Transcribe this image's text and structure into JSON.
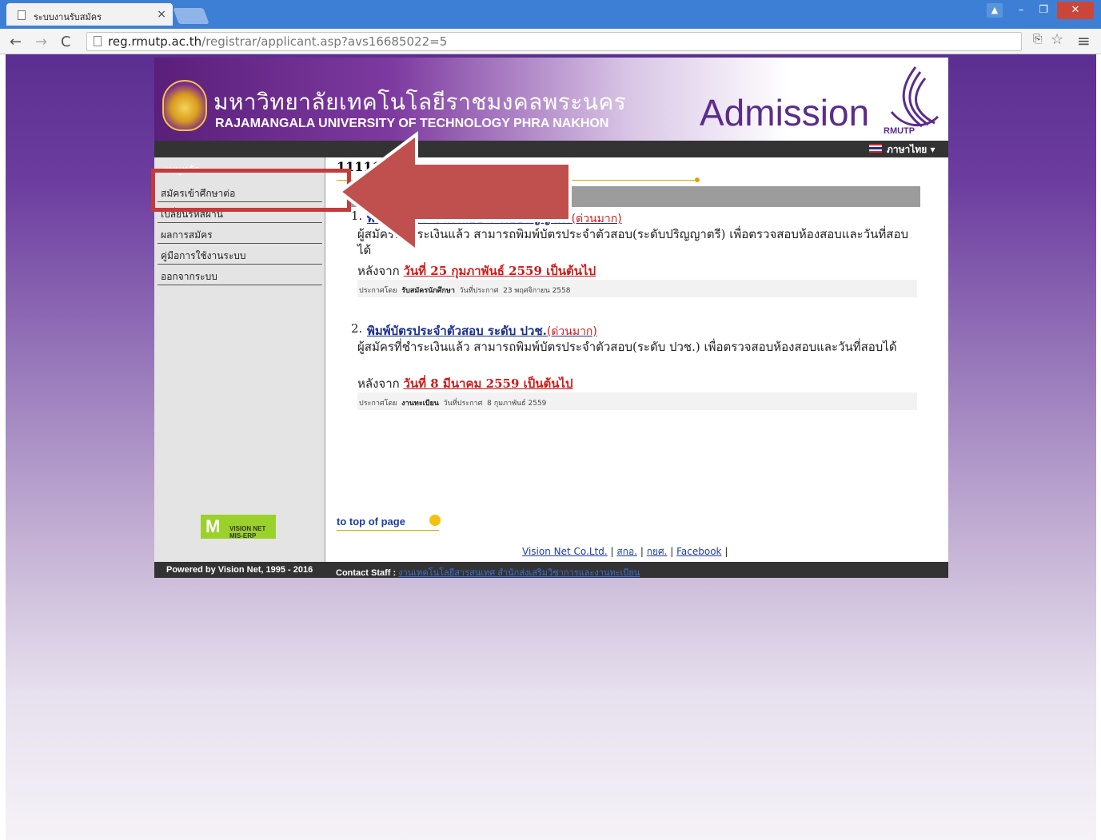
{
  "browser": {
    "tab_title": "ระบบงานรับสมัคร",
    "tab_close": "×",
    "url_host": "reg.rmutp.ac.th",
    "url_path": "/registrar/applicant.asp?avs16685022=5",
    "window_controls": {
      "user": "▲",
      "minimize": "–",
      "maximize": "❐",
      "close": "✕"
    },
    "nav": {
      "back": "←",
      "forward": "→",
      "reload": "C"
    },
    "icons": {
      "translate": "translate-icon",
      "star": "☆",
      "menu": "≡"
    }
  },
  "header": {
    "uni_thai": "มหาวิทยาลัยเทคโนโลยีราชมงคลพระนคร",
    "uni_en": "RAJAMANGALA UNIVERSITY OF TECHNOLOGY PHRA NAKHON",
    "admission": "Admission",
    "logo_text": "RMUTP",
    "language": "ภาษาไทย ▾"
  },
  "sidebar": {
    "title": "เมนูหลัก",
    "items": [
      {
        "label": "สมัครเข้าศึกษาต่อ"
      },
      {
        "label": "เปลี่ยนรหัสผ่าน"
      },
      {
        "label": "ผลการสมัคร"
      },
      {
        "label": "คู่มือการใช้งานระบบ"
      },
      {
        "label": "ออกจากระบบ"
      }
    ],
    "vn_logo": {
      "mark": "M",
      "text": "VISION NET MIS-ERP"
    }
  },
  "content": {
    "heading": "11111",
    "announcements": [
      {
        "number": "1.",
        "title": "พิมพ์บัตรประจำตัวสอบ ระดับปริญญาตรี",
        "urgent": "(ด่วนมาก)",
        "desc": "ผู้สมัครที่ชำระเงินแล้ว สามารถพิมพ์บัตรประจำตัวสอบ(ระดับปริญญาตรี) เพื่อตรวจสอบห้องสอบและวันที่สอบได้",
        "after_label": "หลังจาก",
        "after_date": "วันที่ 25 กุมภาพันธ์ 2559 เป็นต้นไป",
        "by_label": "ประกาศโดย",
        "by": "รับสมัครนักศึกษา",
        "date_label": "วันที่ประกาศ",
        "date": "23 พฤศจิกายน 2558"
      },
      {
        "number": "2.",
        "title": "พิมพ์บัตรประจำตัวสอบ ระดับ ปวช.",
        "urgent": "(ด่วนมาก)",
        "desc": "ผู้สมัครที่ชำระเงินแล้ว สามารถพิมพ์บัตรประจำตัวสอบ(ระดับ ปวช.) เพื่อตรวจสอบห้องสอบและวันที่สอบได้",
        "after_label": "หลังจาก",
        "after_date": "วันที่ 8 มีนาคม 2559 เป็นต้นไป",
        "by_label": "ประกาศโดย",
        "by": "งานทะเบียน",
        "date_label": "วันที่ประกาศ",
        "date": "8 กุมภาพันธ์ 2559"
      }
    ],
    "to_top": "to top of page",
    "footer_links": [
      "Vision Net Co.Ltd.",
      "สกอ.",
      "กยศ.",
      "Facebook"
    ],
    "footer_sep": "|"
  },
  "footer": {
    "powered": "Powered by Vision Net, 1995 - 2016",
    "contact_label": "Contact Staff :",
    "contact_link": "งานเทคโนโลยีสารสนเทศ สำนักส่งเสริมวิชาการและงานทะเบียน"
  },
  "colors": {
    "browser_blue": "#3e7fd6",
    "site_purple": "#5b2f91",
    "urgent_red": "#d31818",
    "link_blue": "#1b2f8f",
    "annotation_red": "#c33b3b"
  }
}
